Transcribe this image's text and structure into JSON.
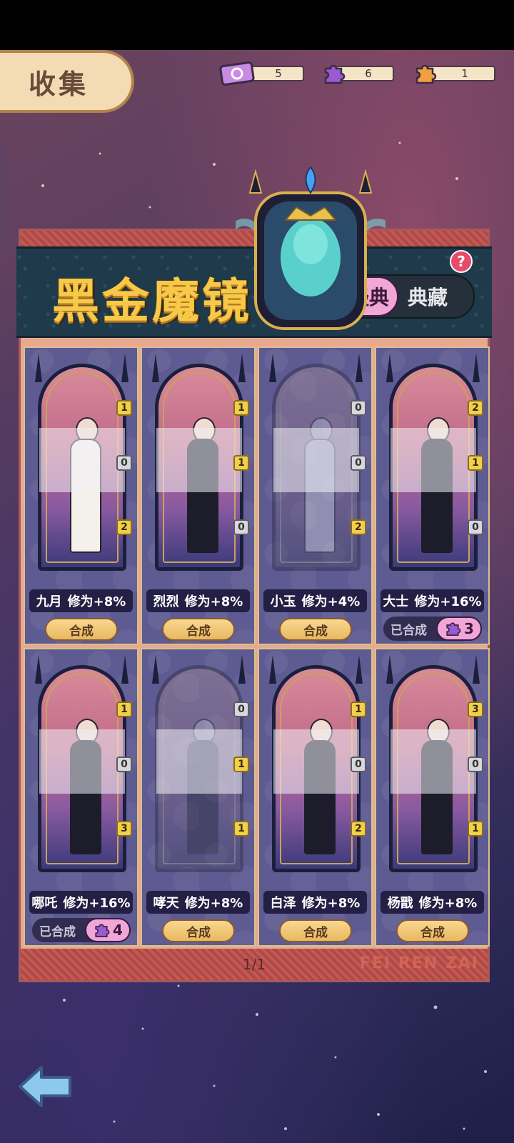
{
  "header": {
    "title": "收集"
  },
  "resources": [
    {
      "icon": "ticket-icon",
      "value": "5",
      "color": "#c88be0"
    },
    {
      "icon": "purple-puzzle-icon",
      "value": "6",
      "color": "#9a5ad0"
    },
    {
      "icon": "orange-puzzle-icon",
      "value": "1",
      "color": "#f0a040"
    }
  ],
  "banner": {
    "title": "黑金魔镜",
    "tabs": {
      "active": "经典",
      "inactive": "典藏"
    },
    "help": "?"
  },
  "cards": [
    {
      "name": "九月",
      "bonus": "修为+8%",
      "badges": [
        "1",
        "0",
        "2"
      ],
      "action": "合成",
      "made": false
    },
    {
      "name": "烈烈",
      "bonus": "修为+8%",
      "badges": [
        "1",
        "1",
        "0"
      ],
      "action": "合成",
      "made": false
    },
    {
      "name": "小玉",
      "bonus": "修为+4%",
      "badges": [
        "0",
        "0",
        "2"
      ],
      "action": "合成",
      "made": false
    },
    {
      "name": "大士",
      "bonus": "修为+16%",
      "badges": [
        "2",
        "1",
        "0"
      ],
      "made": true,
      "made_label": "已合成",
      "made_count": "3"
    },
    {
      "name": "哪吒",
      "bonus": "修为+16%",
      "badges": [
        "1",
        "0",
        "3"
      ],
      "made": true,
      "made_label": "已合成",
      "made_count": "4"
    },
    {
      "name": "哮天",
      "bonus": "修为+8%",
      "badges": [
        "0",
        "1",
        "1"
      ],
      "action": "合成",
      "made": false
    },
    {
      "name": "白泽",
      "bonus": "修为+8%",
      "badges": [
        "1",
        "0",
        "2"
      ],
      "action": "合成",
      "made": false
    },
    {
      "name": "杨戬",
      "bonus": "修为+8%",
      "badges": [
        "3",
        "0",
        "1"
      ],
      "action": "合成",
      "made": false
    }
  ],
  "footer": {
    "page": "1/1",
    "watermark": "FEI REN ZAI"
  },
  "colors": {
    "accent_pink": "#f2a6d8",
    "gold": "#f6c948",
    "card_bg": "#5e5a92"
  }
}
